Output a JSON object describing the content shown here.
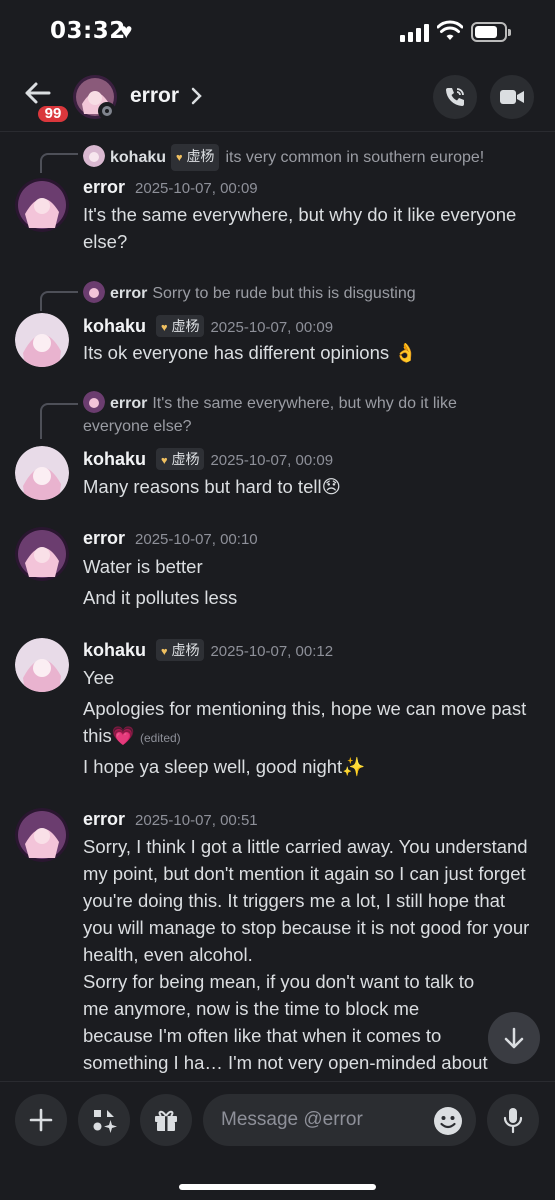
{
  "status_bar": {
    "time": "03:32"
  },
  "header": {
    "title": "error",
    "badge": "99"
  },
  "messages": [
    {
      "reply": {
        "author": "kohaku",
        "tag": "虚杨",
        "text": "its very common in southern europe!"
      },
      "author": "error",
      "timestamp": "2025-10-07, 00:09",
      "lines": [
        "It's the same everywhere, but why do it like everyone else?"
      ]
    },
    {
      "reply": {
        "author": "error",
        "text": "Sorry to be rude but this is disgusting"
      },
      "author": "kohaku",
      "tag": "虚杨",
      "timestamp": "2025-10-07, 00:09",
      "lines": [
        "Its ok everyone has different opinions 👌"
      ]
    },
    {
      "reply": {
        "author": "error",
        "text": "It's the same everywhere, but why do it like everyone else?"
      },
      "author": "kohaku",
      "tag": "虚杨",
      "timestamp": "2025-10-07, 00:09",
      "lines": [
        "Many reasons but hard to tell😞"
      ]
    },
    {
      "author": "error",
      "timestamp": "2025-10-07, 00:10",
      "lines": [
        "Water is better",
        "And it pollutes less"
      ]
    },
    {
      "author": "kohaku",
      "tag": "虚杨",
      "timestamp": "2025-10-07, 00:12",
      "lines": [
        "Yee",
        "Apologies for mentioning this, hope we can move past this💗",
        "I hope ya sleep well, good night✨"
      ],
      "edited": "(edited)"
    },
    {
      "author": "error",
      "timestamp": "2025-10-07, 00:51",
      "lines": [
        "Sorry, I think I got a little carried away. You understand my point, but don't mention it again so I can just forget you're doing this. It triggers me a lot, I still hope that you will manage to stop because it is not good for your health, even alcohol.",
        "Sorry for being mean, if you don't want to talk to me anymore, now is the time to block me because I'm often like that when it comes to something I ha… I'm not very open-minded about that."
      ]
    }
  ],
  "composer": {
    "placeholder": "Message @error"
  },
  "colors": {
    "background": "#1b1c20",
    "badge": "#da373c",
    "text": "#dbdee1",
    "muted": "#8e9099"
  }
}
